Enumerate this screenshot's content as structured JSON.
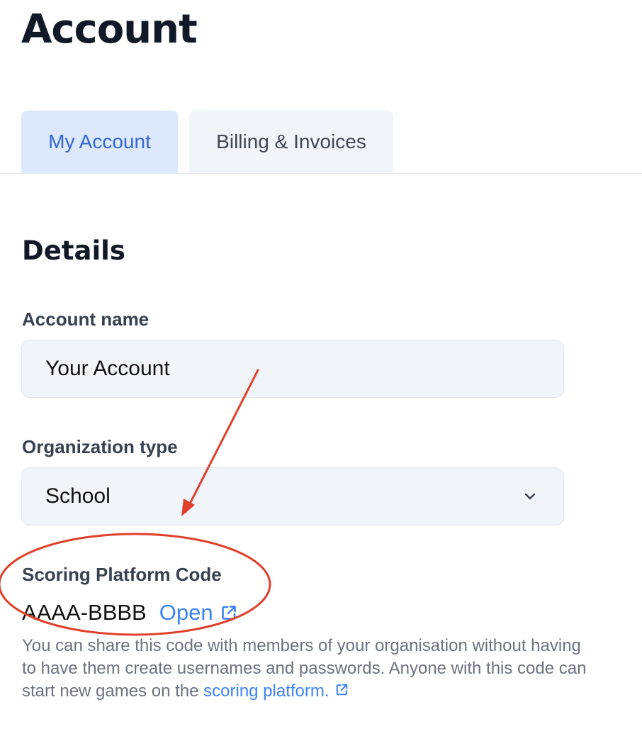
{
  "header": {
    "title": "Account"
  },
  "tabs": [
    {
      "label": "My Account",
      "active": true
    },
    {
      "label": "Billing & Invoices",
      "active": false
    }
  ],
  "details": {
    "title": "Details",
    "account_name": {
      "label": "Account name",
      "value": "Your Account"
    },
    "organization_type": {
      "label": "Organization type",
      "value": "School"
    },
    "scoring_code": {
      "label": "Scoring Platform Code",
      "value": "AAAA-BBBB",
      "open_label": "Open",
      "help_prefix": "You can share this code with members of your organisation without having to have them create usernames and passwords. Anyone with this code can start new games on the ",
      "help_link": "scoring platform."
    }
  },
  "icons": {
    "select": "chevron-down-icon",
    "open": "external-link-icon"
  },
  "colors": {
    "accent": "#3b82f6",
    "tab_active_bg": "#dde8fb",
    "annotation": "#e0402a"
  }
}
